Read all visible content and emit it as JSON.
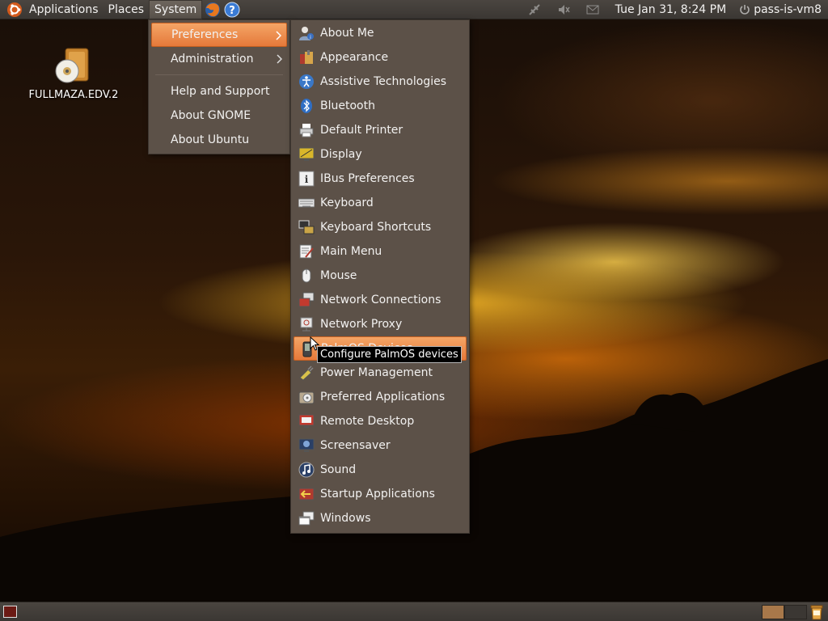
{
  "top_panel": {
    "menus": [
      "Applications",
      "Places",
      "System"
    ],
    "clock": "Tue Jan 31,  8:24 PM",
    "user": "pass-is-vm8"
  },
  "desktop_icons": [
    {
      "label": "FULLMAZA.EDV.2"
    }
  ],
  "system_menu": {
    "items": [
      {
        "label": "Preferences"
      },
      {
        "label": "Administration"
      },
      {
        "label": "Help and Support"
      },
      {
        "label": "About GNOME"
      },
      {
        "label": "About Ubuntu"
      }
    ]
  },
  "preferences_menu": {
    "items": [
      {
        "label": "About Me",
        "icon": "user-info-icon"
      },
      {
        "label": "Appearance",
        "icon": "appearance-icon"
      },
      {
        "label": "Assistive Technologies",
        "icon": "accessibility-icon"
      },
      {
        "label": "Bluetooth",
        "icon": "bluetooth-icon"
      },
      {
        "label": "Default Printer",
        "icon": "printer-icon"
      },
      {
        "label": "Display",
        "icon": "display-icon"
      },
      {
        "label": "IBus Preferences",
        "icon": "info-icon"
      },
      {
        "label": "Keyboard",
        "icon": "keyboard-icon"
      },
      {
        "label": "Keyboard Shortcuts",
        "icon": "keyboard-shortcuts-icon"
      },
      {
        "label": "Main Menu",
        "icon": "main-menu-icon"
      },
      {
        "label": "Mouse",
        "icon": "mouse-icon"
      },
      {
        "label": "Network Connections",
        "icon": "network-icon"
      },
      {
        "label": "Network Proxy",
        "icon": "proxy-icon"
      },
      {
        "label": "PalmOS Devices",
        "icon": "palmos-icon"
      },
      {
        "label": "Power Management",
        "icon": "power-management-icon"
      },
      {
        "label": "Preferred Applications",
        "icon": "preferred-apps-icon"
      },
      {
        "label": "Remote Desktop",
        "icon": "remote-desktop-icon"
      },
      {
        "label": "Screensaver",
        "icon": "screensaver-icon"
      },
      {
        "label": "Sound",
        "icon": "sound-icon"
      },
      {
        "label": "Startup Applications",
        "icon": "startup-icon"
      },
      {
        "label": "Windows",
        "icon": "windows-icon"
      }
    ]
  },
  "tooltip": "Configure PalmOS devices",
  "colors": {
    "menu_bg": "#5c5148",
    "highlight": "#e5793a",
    "panel": "#3b3733"
  }
}
